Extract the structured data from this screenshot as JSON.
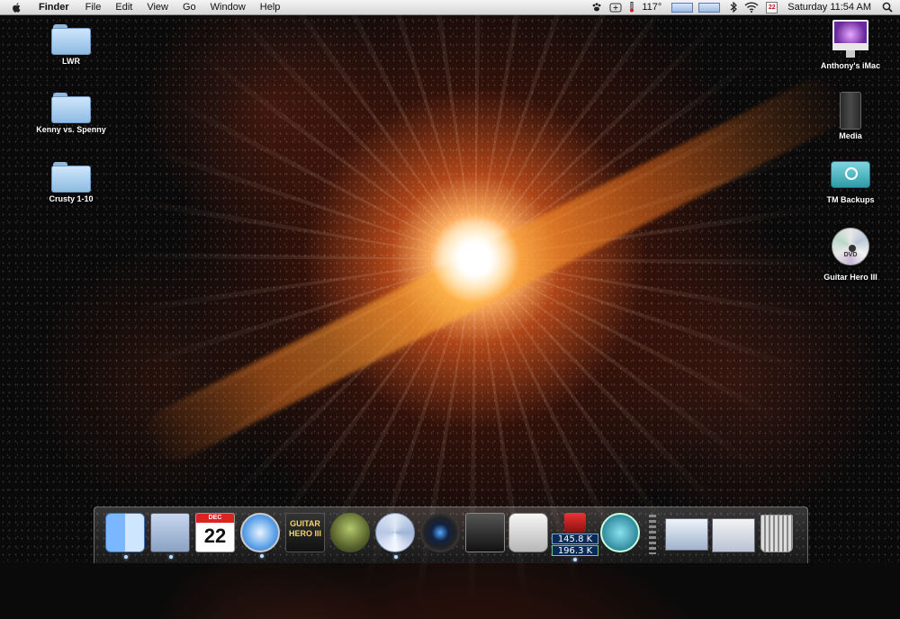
{
  "menubar": {
    "app_name": "Finder",
    "menus": [
      "File",
      "Edit",
      "View",
      "Go",
      "Window",
      "Help"
    ],
    "temperature": "117°",
    "clock_date_icon": "22",
    "clock": "Saturday 11:54 AM"
  },
  "desktop": {
    "left_icons": [
      {
        "label": "LWR",
        "icon": "folder-icon"
      },
      {
        "label": "Kenny vs. Spenny",
        "icon": "folder-icon"
      },
      {
        "label": "Crusty 1-10",
        "icon": "folder-icon"
      }
    ],
    "right_icons": [
      {
        "label": "Anthony's iMac",
        "icon": "imac-icon"
      },
      {
        "label": "Media",
        "icon": "hard-drive-icon"
      },
      {
        "label": "TM Backups",
        "icon": "time-machine-drive-icon"
      },
      {
        "label": "Guitar Hero III",
        "icon": "dvd-icon",
        "disc_text": "DVD"
      }
    ]
  },
  "dock": {
    "items": [
      {
        "name": "finder-icon",
        "running": true
      },
      {
        "name": "mail-icon",
        "running": true
      },
      {
        "name": "ical-icon",
        "running": false,
        "month": "DEC",
        "day": "22"
      },
      {
        "name": "safari-icon",
        "running": true
      },
      {
        "name": "guitar-hero-icon",
        "running": false,
        "text": "GUITAR HERO III"
      },
      {
        "name": "halo-icon",
        "running": false
      },
      {
        "name": "itunes-icon",
        "running": true
      },
      {
        "name": "camera-icon",
        "running": false
      },
      {
        "name": "imovie-icon",
        "running": false
      },
      {
        "name": "ichat-icon",
        "running": false
      },
      {
        "name": "network-meter-icon",
        "running": true,
        "upload": "145.8 K",
        "download": "196.3 K"
      },
      {
        "name": "time-machine-icon",
        "running": false
      },
      {
        "name": "documents-stack-icon",
        "running": false
      },
      {
        "name": "downloads-stack-icon",
        "running": false
      },
      {
        "name": "trash-icon",
        "running": false
      }
    ]
  }
}
